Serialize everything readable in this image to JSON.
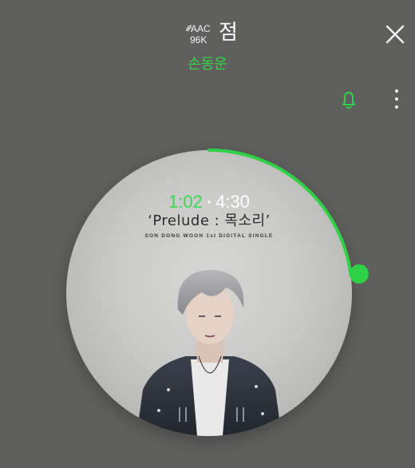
{
  "header": {
    "codec_format": "AAC",
    "codec_rate": "96K",
    "song_title": "점",
    "artist": "손동운"
  },
  "actions": {
    "close_icon": "close-icon",
    "bell_icon": "bell-icon",
    "more_icon": "more-vertical-icon"
  },
  "player": {
    "current_time": "1:02",
    "separator": "•",
    "total_time": "4:30",
    "album_title": "‘Prelude : 목소리’",
    "album_subtitle": "SON DONG WOON 1st DIGITAL SINGLE",
    "progress_fraction": 0.23
  },
  "colors": {
    "accent": "#2fd246",
    "background": "#5f5f5d",
    "text": "#ffffff"
  }
}
